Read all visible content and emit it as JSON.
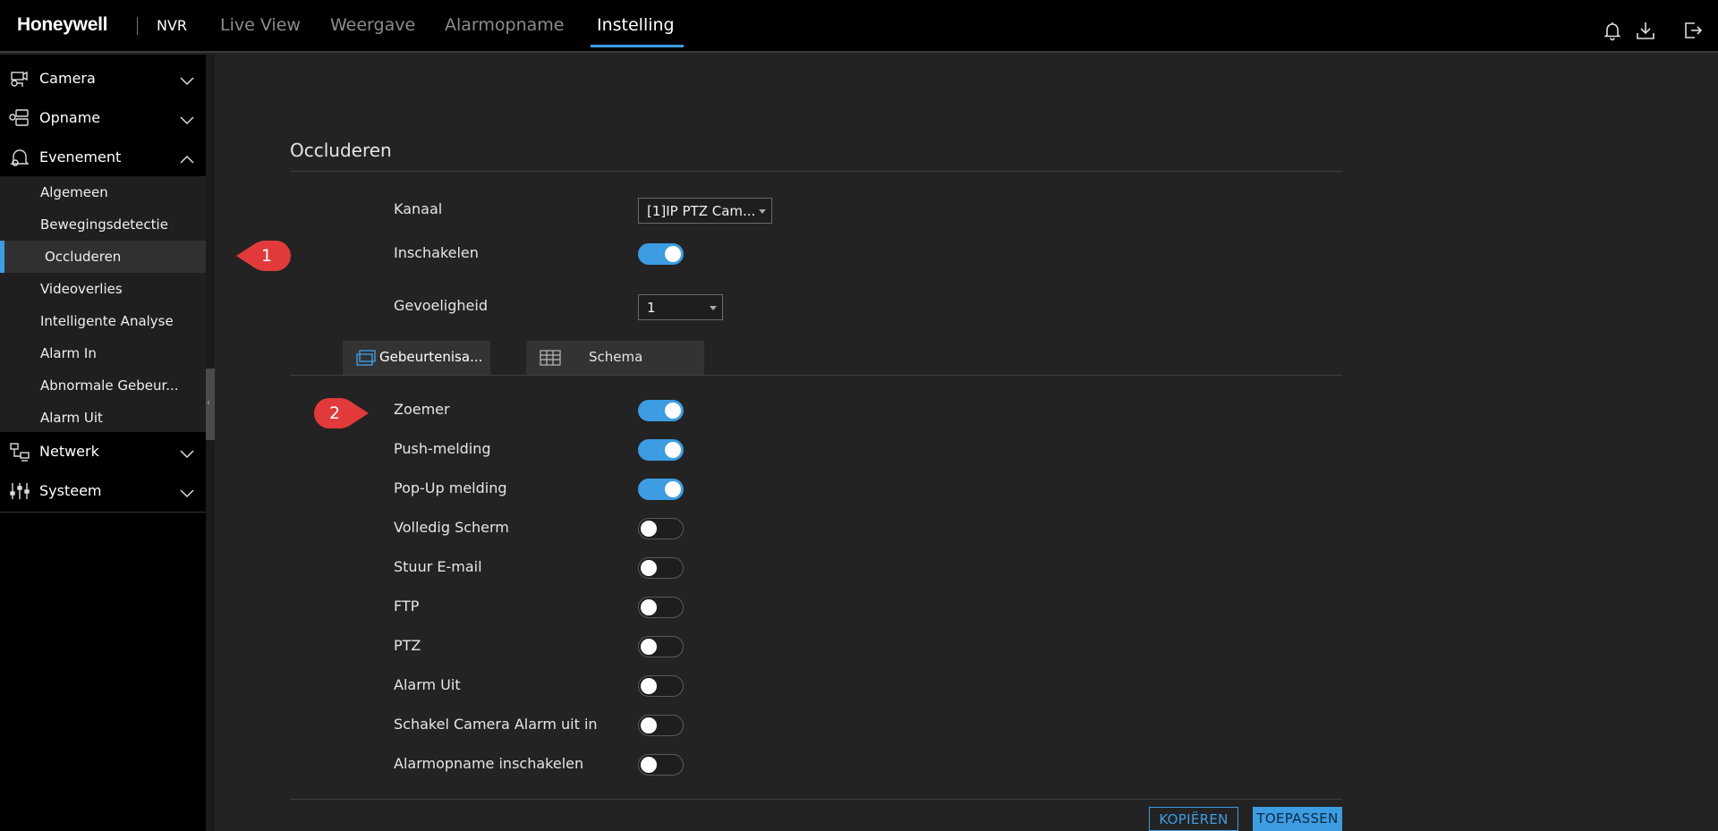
{
  "header": {
    "brand": "Honeywell",
    "product": "NVR",
    "tabs": [
      {
        "label": "Live View"
      },
      {
        "label": "Weergave"
      },
      {
        "label": "Alarmopname"
      },
      {
        "label": "Instelling"
      }
    ],
    "active_tab": "Instelling",
    "icons": [
      "bell-icon",
      "download-icon",
      "logout-icon"
    ]
  },
  "sidebar": {
    "sections": [
      {
        "label": "Camera",
        "icon": "camera-icon",
        "expanded": false
      },
      {
        "label": "Opname",
        "icon": "record-icon",
        "expanded": false
      },
      {
        "label": "Evenement",
        "icon": "event-icon",
        "expanded": true
      },
      {
        "label": "Netwerk",
        "icon": "network-icon",
        "expanded": false
      },
      {
        "label": "Systeem",
        "icon": "system-icon",
        "expanded": false
      }
    ],
    "event_items": [
      {
        "label": "Algemeen"
      },
      {
        "label": "Bewegingsdetectie"
      },
      {
        "label": "Occluderen"
      },
      {
        "label": "Videoverlies"
      },
      {
        "label": "Intelligente Analyse"
      },
      {
        "label": "Alarm In"
      },
      {
        "label": "Abnormale Gebeur..."
      },
      {
        "label": "Alarm Uit"
      }
    ],
    "active_item": "Occluderen"
  },
  "callouts": [
    "1",
    "2"
  ],
  "panel": {
    "title": "Occluderen",
    "kanaal": {
      "label": "Kanaal",
      "value": "[1]IP PTZ Cam..."
    },
    "inschakelen": {
      "label": "Inschakelen",
      "on": true
    },
    "gevoeligheid": {
      "label": "Gevoeligheid",
      "value": "1"
    },
    "subtabs": [
      {
        "label": "Gebeurtenisa...",
        "icon": "event-action-icon",
        "active": true
      },
      {
        "label": "Schema",
        "icon": "schedule-grid-icon",
        "active": false
      }
    ],
    "actions": [
      {
        "label": "Zoemer",
        "on": true
      },
      {
        "label": "Push-melding",
        "on": true
      },
      {
        "label": "Pop-Up melding",
        "on": true
      },
      {
        "label": "Volledig Scherm",
        "on": false
      },
      {
        "label": "Stuur E-mail",
        "on": false
      },
      {
        "label": "FTP",
        "on": false
      },
      {
        "label": "PTZ",
        "on": false
      },
      {
        "label": "Alarm Uit",
        "on": false
      },
      {
        "label": "Schakel Camera Alarm uit in",
        "on": false
      },
      {
        "label": "Alarmopname inschakelen",
        "on": false
      }
    ],
    "buttons": {
      "copy": "KOPIËREN",
      "apply": "TOEPASSEN"
    }
  },
  "colors": {
    "accent": "#3c9de3",
    "callout": "#e23a3a",
    "background": "#232323",
    "sidebar": "#000000"
  }
}
